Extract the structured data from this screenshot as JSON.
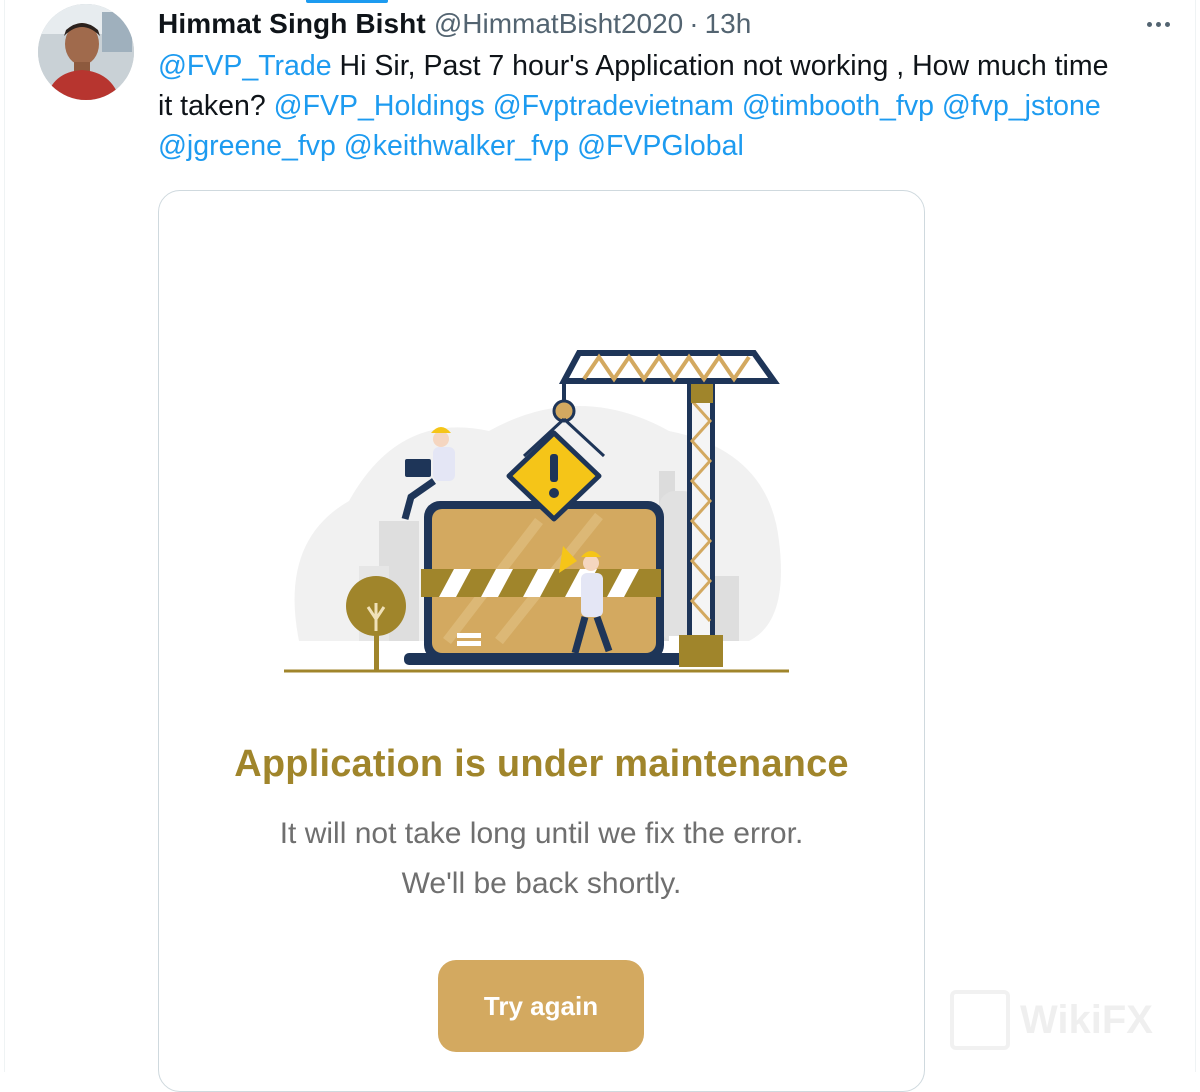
{
  "tweet": {
    "display_name": "Himmat Singh Bisht",
    "handle": "@HimmatBisht2020",
    "separator": "·",
    "time": "13h",
    "more_icon": "more-horizontal-icon",
    "text": {
      "mention_1": "@FVP_Trade",
      "text_1": " Hi Sir, Past 7 hour's Application not working , How much time",
      "text_2": "it taken? ",
      "mention_2": "@FVP_Holdings",
      "mention_3": "@Fvptradevietnam",
      "mention_4": "@timbooth_fvp",
      "mention_5": "@fvp_jstone",
      "mention_6": "@jgreene_fvp",
      "mention_7": "@keithwalker_fvp",
      "mention_8": "@FVPGlobal"
    }
  },
  "card": {
    "title": "Application is under maintenance",
    "line_1": "It will not take long until we fix the error.",
    "line_2": "We'll be back shortly.",
    "button_label": "Try again",
    "illustration_icon": "under-construction-illustration"
  },
  "watermark": {
    "text": "WikiFX"
  },
  "colors": {
    "link": "#1d9bf0",
    "title": "#a0852b",
    "button": "#d3a960",
    "muted": "#536471"
  }
}
